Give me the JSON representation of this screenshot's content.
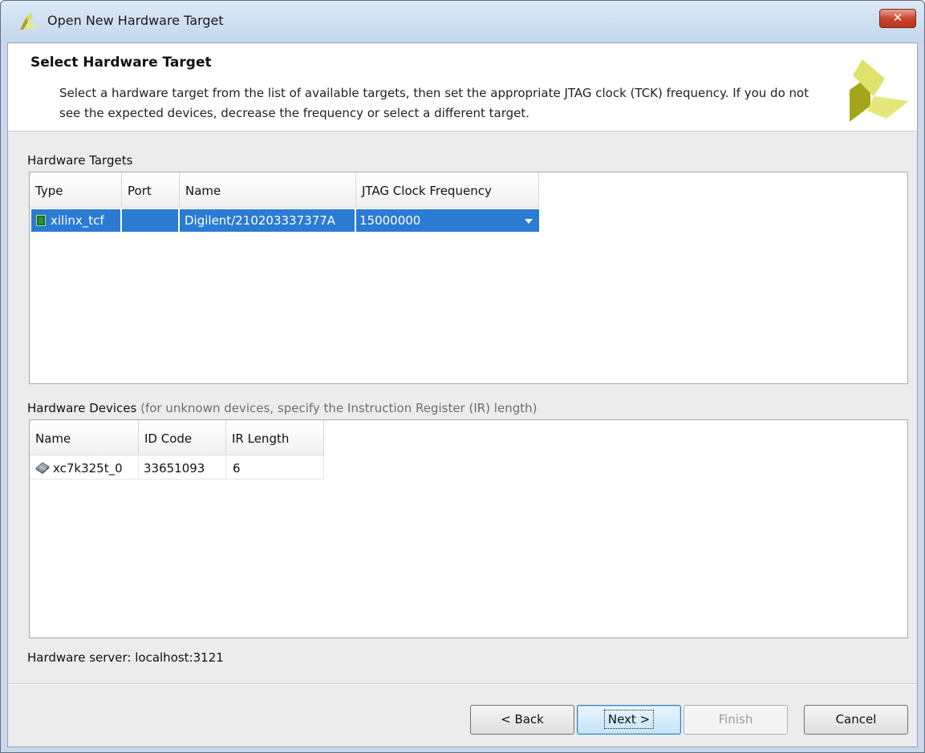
{
  "window": {
    "title": "Open New Hardware Target",
    "close_label": "✕",
    "app_icon": "vivado-logo-icon"
  },
  "header": {
    "title": "Select Hardware Target",
    "description": "Select a hardware target from the list of available targets, then set the appropriate JTAG clock (TCK) frequency. If you do not see the expected devices, decrease the frequency or select a different target.",
    "logo": "xilinx-logo"
  },
  "targets": {
    "label": "Hardware Targets",
    "columns": [
      "Type",
      "Port",
      "Name",
      "JTAG Clock Frequency"
    ],
    "rows": [
      {
        "type": "xilinx_tcf",
        "port": "",
        "name": "Digilent/210203337377A",
        "jtag_freq": "15000000",
        "selected": true
      }
    ]
  },
  "devices": {
    "label": "Hardware Devices",
    "hint": "(for unknown devices, specify the Instruction Register (IR) length)",
    "columns": [
      "Name",
      "ID Code",
      "IR Length"
    ],
    "rows": [
      {
        "name": "xc7k325t_0",
        "id_code": "33651093",
        "ir_length": "6"
      }
    ]
  },
  "server": {
    "text": "Hardware server: localhost:3121"
  },
  "buttons": {
    "back": "< Back",
    "next": "Next >",
    "finish": "Finish",
    "cancel": "Cancel"
  },
  "colors": {
    "selection": "#2b7bd3",
    "title_bar": "#c5d7ec",
    "close_button": "#c7472e",
    "logo_dark": "#a5a519",
    "logo_light": "#e4e87c"
  }
}
